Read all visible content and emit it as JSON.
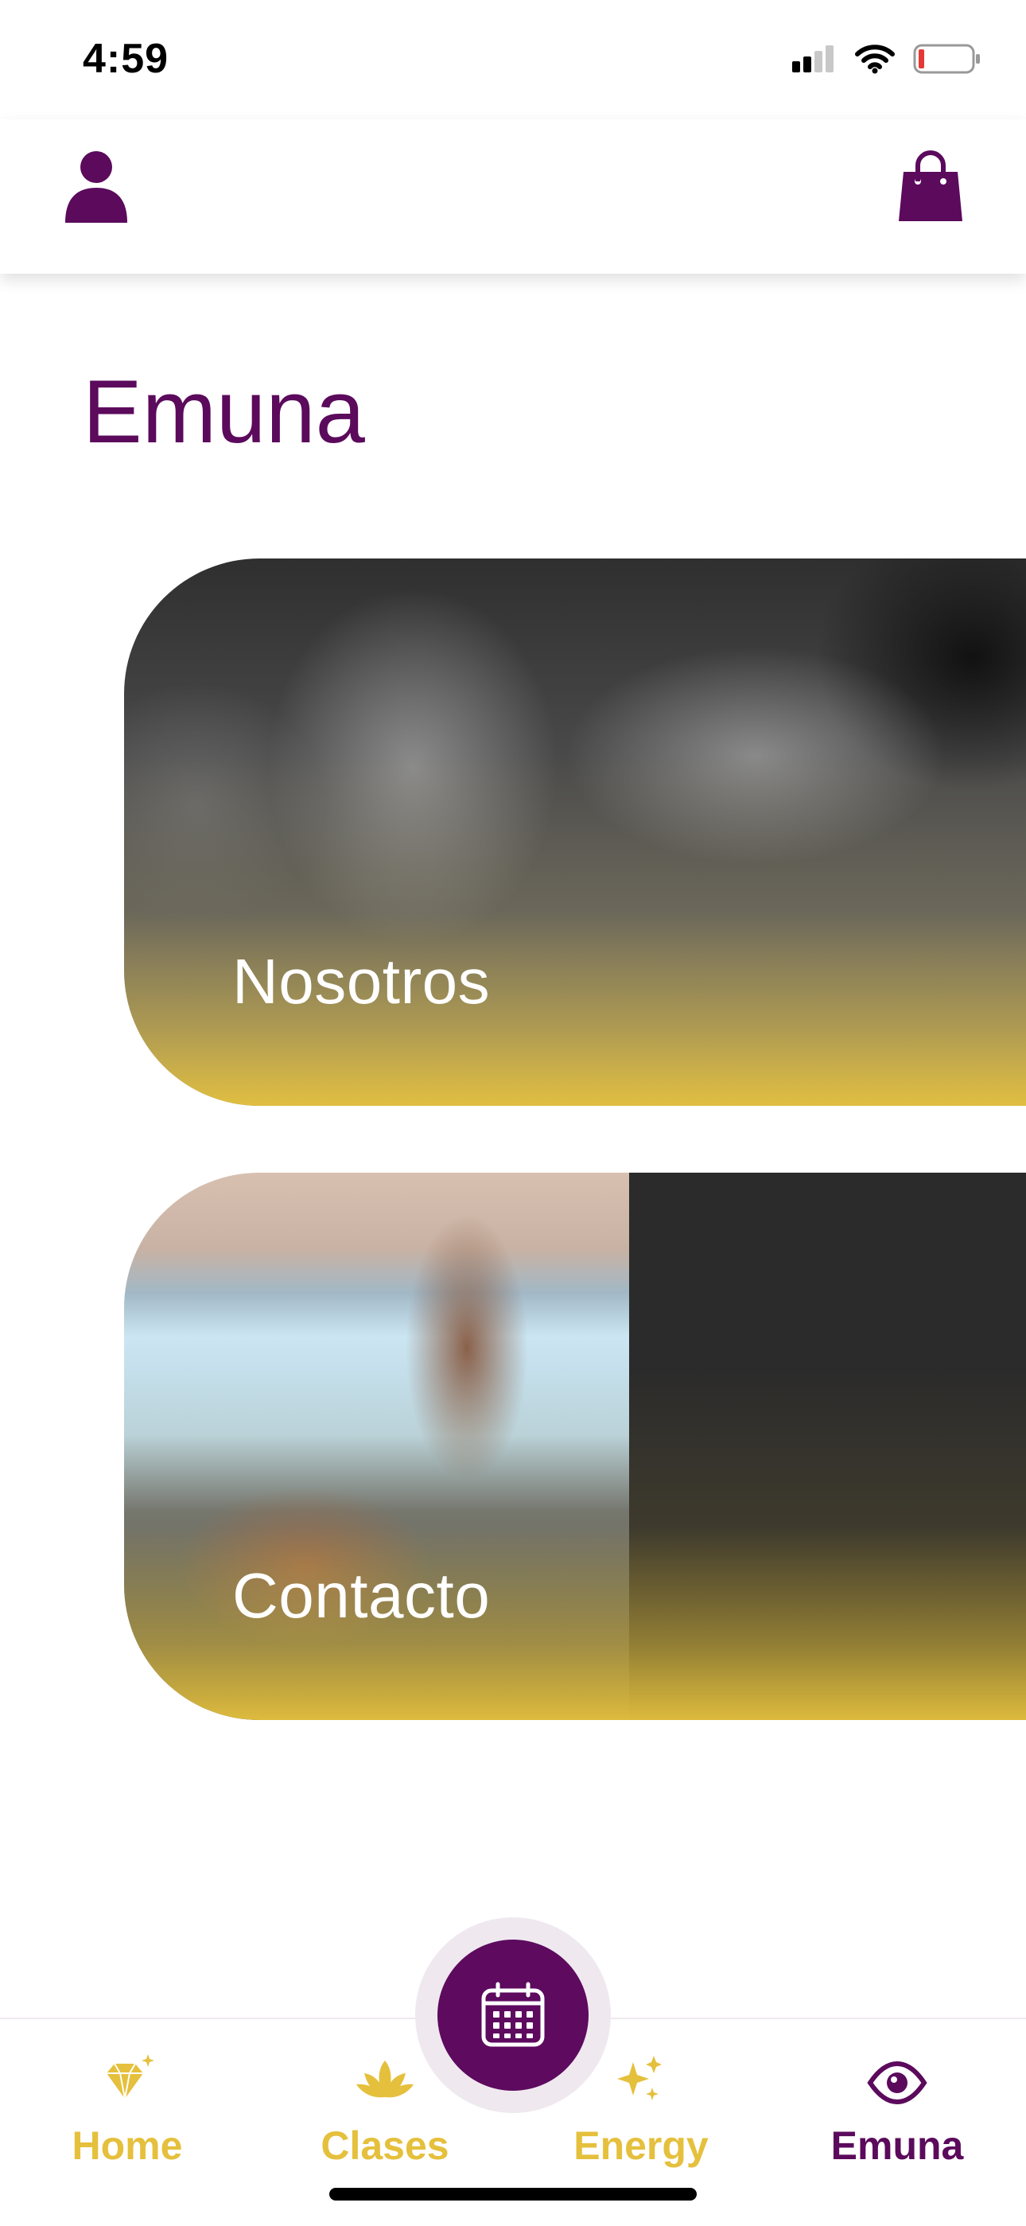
{
  "status_bar": {
    "time": "4:59"
  },
  "header": {
    "profile_icon": "user-icon",
    "bag_icon": "shopping-bag-icon"
  },
  "page": {
    "title": "Emuna"
  },
  "cards": [
    {
      "label": "Nosotros"
    },
    {
      "label": "Contacto"
    }
  ],
  "fab": {
    "icon": "calendar-icon"
  },
  "tabs": [
    {
      "label": "Home",
      "icon": "diamond-icon",
      "active": false
    },
    {
      "label": "Clases",
      "icon": "lotus-icon",
      "active": false
    },
    {
      "label": "Energy",
      "icon": "sparkles-icon",
      "active": false
    },
    {
      "label": "Emuna",
      "icon": "eye-icon",
      "active": true
    }
  ],
  "colors": {
    "primary": "#5b0a5c",
    "accent": "#e5c03d",
    "background": "#ffffff"
  }
}
